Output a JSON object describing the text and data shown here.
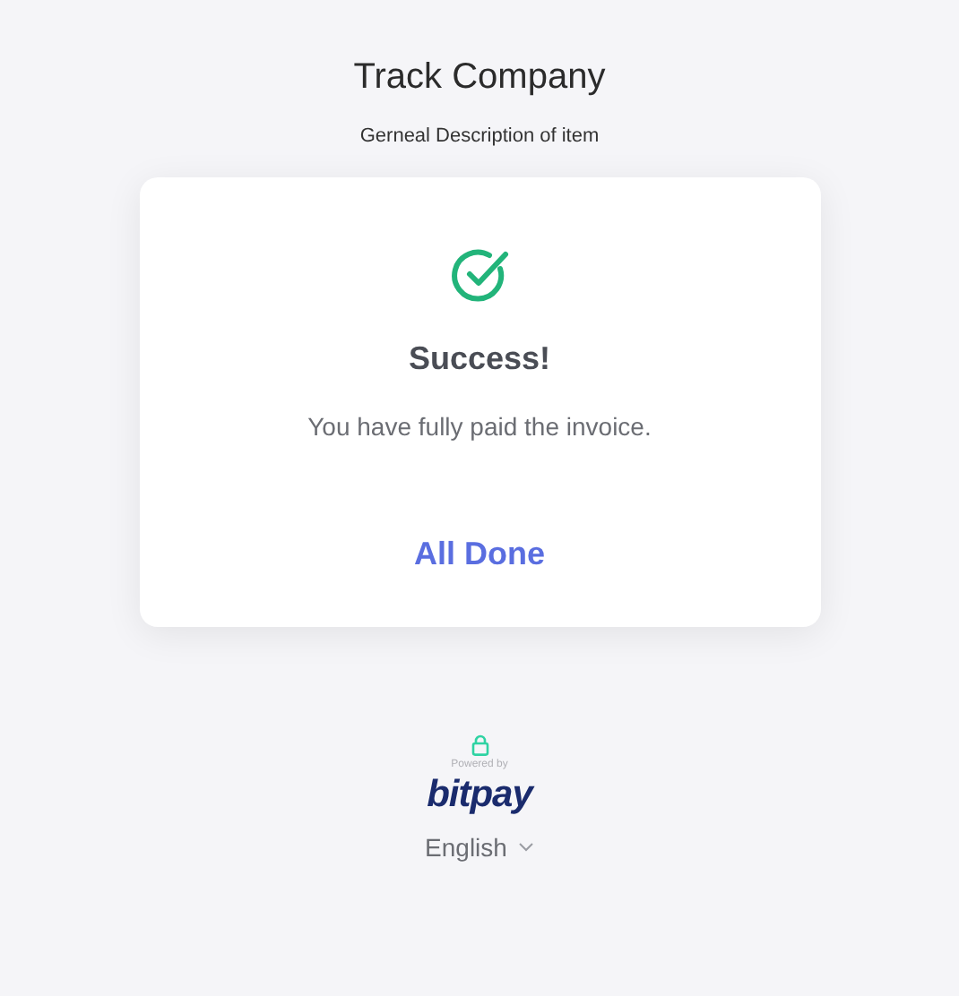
{
  "header": {
    "title": "Track Company",
    "description": "Gerneal Description of item"
  },
  "card": {
    "heading": "Success!",
    "message": "You have fully paid the invoice.",
    "button": "All Done"
  },
  "footer": {
    "powered_by": "Powered by",
    "logo": "bitpay",
    "language": "English"
  }
}
